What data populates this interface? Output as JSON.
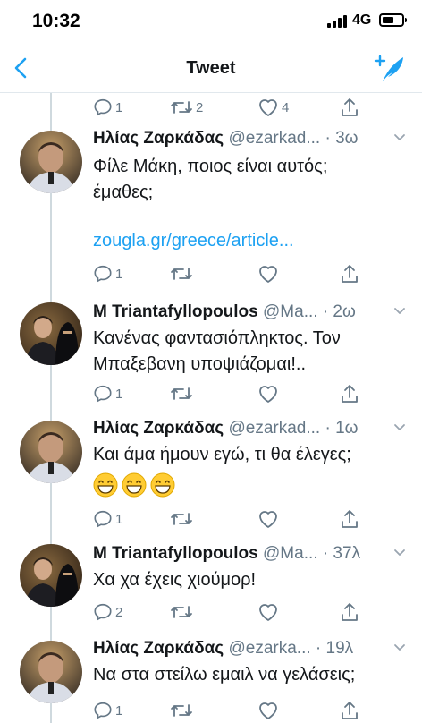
{
  "status_bar": {
    "time": "10:32",
    "network": "4G"
  },
  "nav": {
    "title": "Tweet"
  },
  "top_actions": {
    "replies": "1",
    "retweets": "2",
    "likes": "4"
  },
  "tweets": [
    {
      "name": "Ηλίας Ζαρκάδας",
      "handle": "@ezarkad...",
      "time": "· 3ω",
      "text_lines": [
        "Φίλε Μάκη, ποιος είναι αυτός;",
        "έμαθες;"
      ],
      "link": "zougla.gr/greece/article...",
      "replies": "1",
      "retweets": "",
      "likes": ""
    },
    {
      "name": "M Triantafyllopoulos",
      "handle": "@Ma...",
      "time": "· 2ω",
      "text_lines": [
        "Κανένας φαντασιόπληκτος. Τον",
        "Μπαξεβανη υποψιάζομαι!.."
      ],
      "replies": "1",
      "retweets": "",
      "likes": ""
    },
    {
      "name": "Ηλίας Ζαρκάδας",
      "handle": "@ezarkad...",
      "time": "· 1ω",
      "text_lines": [
        "Και άμα ήμουν εγώ, τι θα έλεγες;"
      ],
      "emoji": "grinning-face-with-smiling-eyes x3",
      "replies": "1",
      "retweets": "",
      "likes": ""
    },
    {
      "name": "M Triantafyllopoulos",
      "handle": "@Ma...",
      "time": "· 37λ",
      "text_lines": [
        "Χα χα έχεις χιούμορ!"
      ],
      "replies": "2",
      "retweets": "",
      "likes": ""
    },
    {
      "name": "Ηλίας Ζαρκάδας",
      "handle": "@ezarka...",
      "time": "· 19λ",
      "text_lines": [
        "Να στα στείλω εμαιλ να γελάσεις;"
      ],
      "replies": "1",
      "retweets": "",
      "likes": ""
    }
  ],
  "colors": {
    "accent": "#1da1f2",
    "secondary_text": "#657786",
    "divider": "#e1e8ed"
  }
}
